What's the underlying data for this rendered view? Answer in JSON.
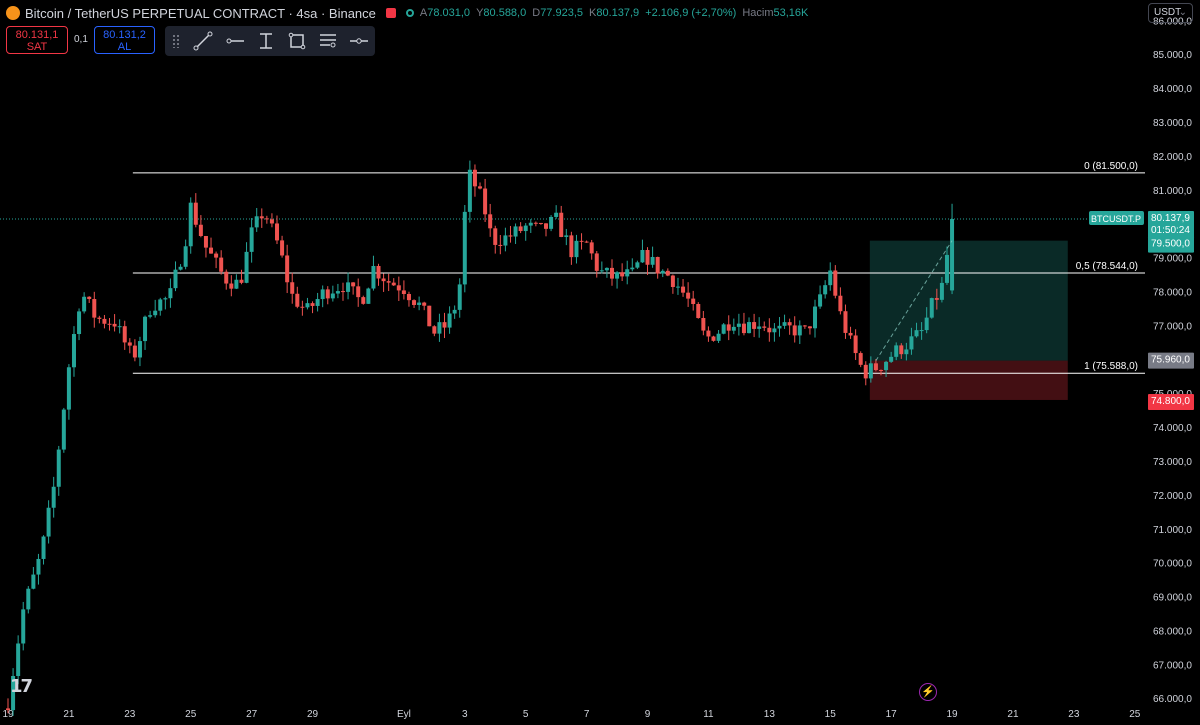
{
  "header": {
    "title": "Bitcoin / TetherUS PERPETUAL CONTRACT · 4sa · Binance",
    "ohlc": [
      {
        "k": "A",
        "v": "78.031,0"
      },
      {
        "k": "Y",
        "v": "80.588,0"
      },
      {
        "k": "D",
        "v": "77.923,5"
      },
      {
        "k": "K",
        "v": "80.137,9"
      },
      {
        "k": "",
        "v": "+2.106,9 (+2,70%)"
      },
      {
        "k": "Hacim",
        "v": "53,16K"
      }
    ]
  },
  "trade": {
    "sell_price": "80.131,1",
    "sell_label": "SAT",
    "buy_price": "80.131,2",
    "buy_label": "AL",
    "spread": "0,1"
  },
  "toolbar": {
    "icons": [
      "trend-line-icon",
      "horizontal-ray-icon",
      "vertical-line-icon",
      "rectangle-icon",
      "text-lines-icon",
      "horizontal-line-icon"
    ]
  },
  "currency": "USDT",
  "colors": {
    "up": "#26a69a",
    "down": "#ef5350",
    "background": "#000000",
    "fib_line": "#ffffff",
    "profit_zone": "rgba(38,166,154,0.25)",
    "loss_zone": "rgba(242,54,69,0.28)"
  },
  "chart_data": {
    "type": "candlestick",
    "symbol": "BTCUSDT.P",
    "interval": "4h",
    "y_axis": {
      "min": 65800,
      "max": 86600,
      "ticks": [
        66000,
        67000,
        68000,
        69000,
        70000,
        71000,
        72000,
        73000,
        74000,
        75000,
        76000,
        77000,
        78000,
        79000,
        80000,
        81000,
        82000,
        83000,
        84000,
        85000,
        86000
      ],
      "tick_labels": [
        "66.000,0",
        "67.000,0",
        "68.000,0",
        "69.000,0",
        "70.000,0",
        "71.000,0",
        "72.000,0",
        "73.000,0",
        "74.000,0",
        "75.000,0",
        "76.000,0",
        "77.000,0",
        "78.000,0",
        "79.000,0",
        "80.000,0",
        "81.000,0",
        "82.000,0",
        "83.000,0",
        "84.000,0",
        "85.000,0",
        "86.000,0"
      ]
    },
    "x_axis": {
      "labels": [
        {
          "text": "19",
          "day": 0
        },
        {
          "text": "21",
          "day": 2
        },
        {
          "text": "23",
          "day": 4
        },
        {
          "text": "25",
          "day": 6
        },
        {
          "text": "27",
          "day": 8
        },
        {
          "text": "29",
          "day": 10
        },
        {
          "text": "Eyl",
          "day": 13
        },
        {
          "text": "3",
          "day": 15
        },
        {
          "text": "5",
          "day": 17
        },
        {
          "text": "7",
          "day": 19
        },
        {
          "text": "9",
          "day": 21
        },
        {
          "text": "11",
          "day": 23
        },
        {
          "text": "13",
          "day": 25
        },
        {
          "text": "15",
          "day": 27
        },
        {
          "text": "17",
          "day": 29
        },
        {
          "text": "19",
          "day": 31
        },
        {
          "text": "21",
          "day": 33
        },
        {
          "text": "23",
          "day": 35
        },
        {
          "text": "25",
          "day": 37
        }
      ],
      "day_span": [
        0,
        37.5
      ]
    },
    "anchors": [
      [
        0,
        65900
      ],
      [
        0.5,
        68600
      ],
      [
        1.1,
        70300
      ],
      [
        1.5,
        72200
      ],
      [
        2.0,
        75800
      ],
      [
        2.4,
        78000
      ],
      [
        2.9,
        77200
      ],
      [
        3.5,
        77100
      ],
      [
        4.1,
        76000
      ],
      [
        4.7,
        77600
      ],
      [
        5.3,
        77800
      ],
      [
        5.8,
        79400
      ],
      [
        6.0,
        80500
      ],
      [
        6.5,
        79300
      ],
      [
        7.1,
        78400
      ],
      [
        7.6,
        78200
      ],
      [
        8.0,
        79700
      ],
      [
        8.4,
        80400
      ],
      [
        8.9,
        79300
      ],
      [
        9.3,
        77900
      ],
      [
        9.8,
        77400
      ],
      [
        10.4,
        78000
      ],
      [
        11.0,
        78200
      ],
      [
        11.6,
        77700
      ],
      [
        12.0,
        78700
      ],
      [
        12.5,
        78300
      ],
      [
        13.0,
        78100
      ],
      [
        13.5,
        77600
      ],
      [
        14.0,
        76800
      ],
      [
        14.4,
        77000
      ],
      [
        14.8,
        77800
      ],
      [
        15.1,
        81500
      ],
      [
        15.3,
        81200
      ],
      [
        15.6,
        80600
      ],
      [
        15.9,
        79500
      ],
      [
        16.4,
        79600
      ],
      [
        17.0,
        79900
      ],
      [
        17.5,
        79800
      ],
      [
        18.0,
        80100
      ],
      [
        18.5,
        79200
      ],
      [
        19.0,
        79400
      ],
      [
        19.4,
        78600
      ],
      [
        19.9,
        78400
      ],
      [
        20.5,
        78500
      ],
      [
        20.9,
        79100
      ],
      [
        21.3,
        78700
      ],
      [
        21.8,
        78400
      ],
      [
        22.3,
        77800
      ],
      [
        22.9,
        76600
      ],
      [
        23.3,
        76800
      ],
      [
        23.8,
        77200
      ],
      [
        24.2,
        77000
      ],
      [
        24.7,
        77100
      ],
      [
        25.2,
        76800
      ],
      [
        25.7,
        76900
      ],
      [
        26.2,
        76800
      ],
      [
        26.7,
        77800
      ],
      [
        27.0,
        78600
      ],
      [
        27.3,
        77400
      ],
      [
        27.7,
        76400
      ],
      [
        28.1,
        75600
      ],
      [
        28.6,
        75800
      ],
      [
        29.1,
        76200
      ],
      [
        29.6,
        76500
      ],
      [
        30.0,
        76800
      ],
      [
        30.3,
        77500
      ],
      [
        30.7,
        78200
      ],
      [
        31.0,
        80138
      ]
    ],
    "last_candle": {
      "open": 78031.0,
      "high": 80588.0,
      "low": 77923.5,
      "close": 80137.9
    },
    "fib_retracement": [
      {
        "level": "0",
        "price": 81500,
        "label": "0 (81.500,0)"
      },
      {
        "level": "0.5",
        "price": 78544,
        "label": "0,5 (78.544,0)"
      },
      {
        "level": "1",
        "price": 75588,
        "label": "1 (75.588,0)"
      }
    ],
    "long_position": {
      "entry": 75960,
      "target": 79500,
      "stop": 74800,
      "start_day": 28.3,
      "end_day": 34.8,
      "labels": {
        "entry": "75.960,0",
        "target": "79.500,0",
        "stop": "74.800,0"
      }
    },
    "price_tag": {
      "symbol": "BTCUSDT.P",
      "price": "80.137,9",
      "countdown": "01:50:24"
    }
  }
}
